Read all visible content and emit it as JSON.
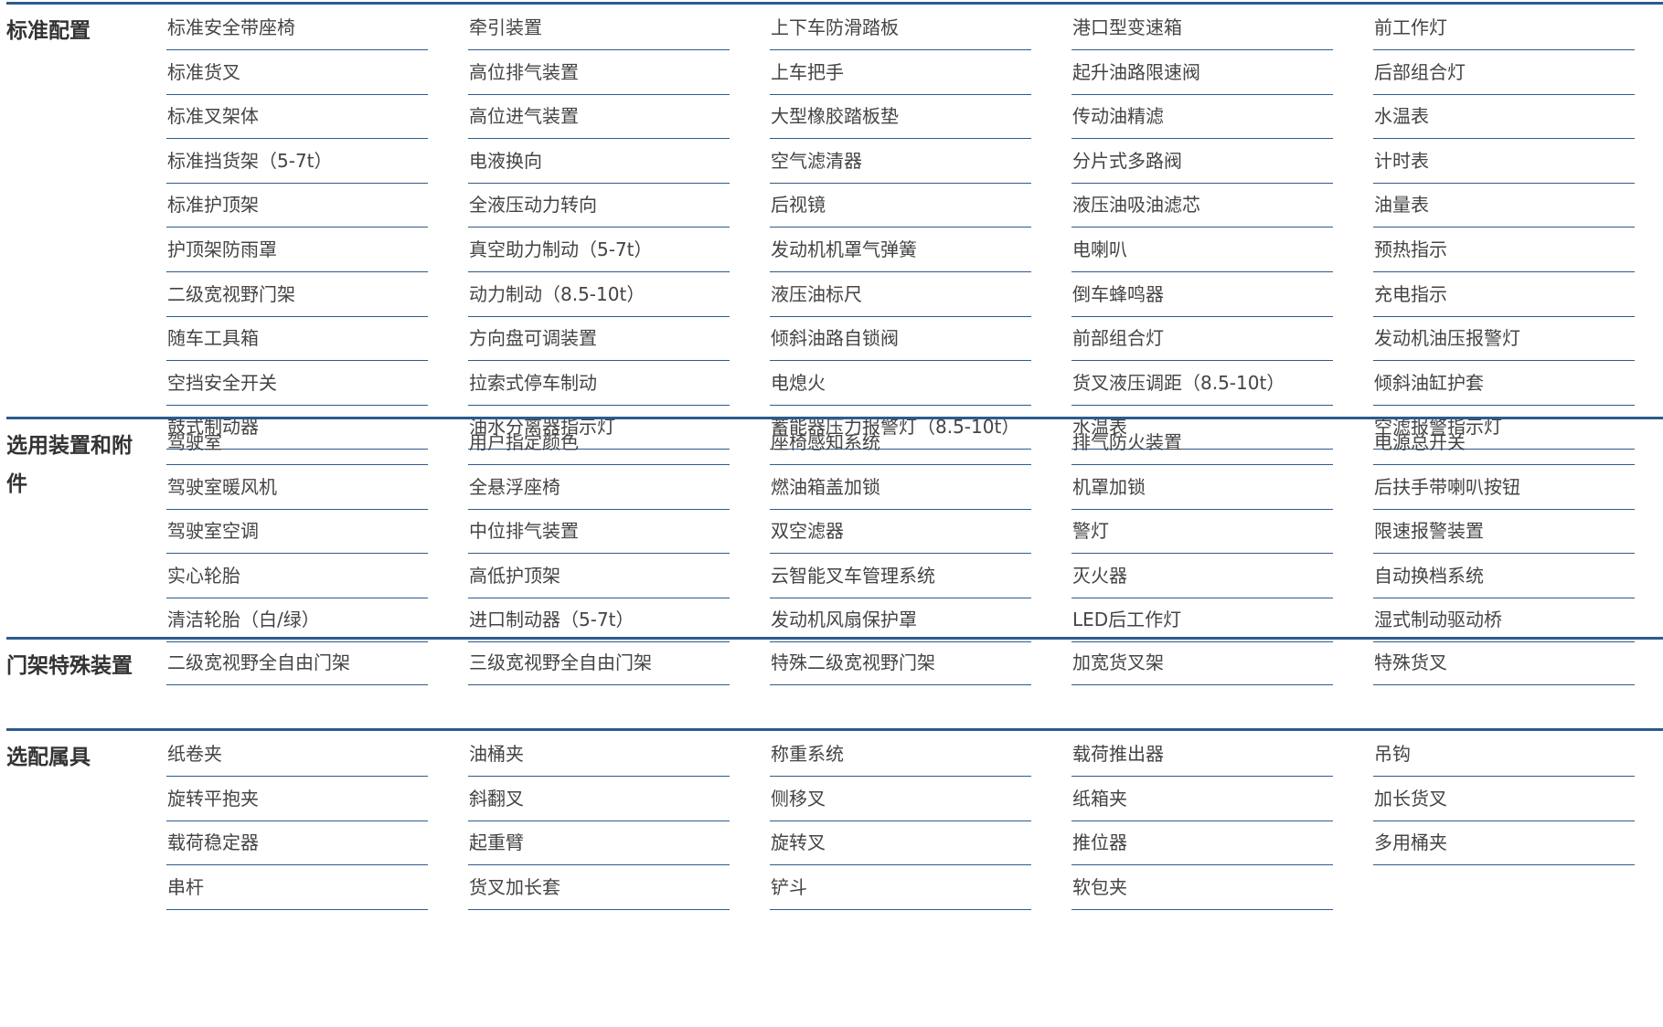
{
  "sections": [
    {
      "title": "标准配置",
      "items": [
        "标准安全带座椅",
        "牵引装置",
        "上下车防滑踏板",
        "港口型变速箱",
        "前工作灯",
        "标准货叉",
        "高位排气装置",
        "上车把手",
        "起升油路限速阀",
        "后部组合灯",
        "标准叉架体",
        "高位进气装置",
        "大型橡胶踏板垫",
        "传动油精滤",
        "水温表",
        "标准挡货架（5-7t）",
        "电液换向",
        "空气滤清器",
        "分片式多路阀",
        "计时表",
        "标准护顶架",
        "全液压动力转向",
        "后视镜",
        "液压油吸油滤芯",
        "油量表",
        "护顶架防雨罩",
        "真空助力制动（5-7t）",
        "发动机机罩气弹簧",
        "电喇叭",
        "预热指示",
        "二级宽视野门架",
        "动力制动（8.5-10t）",
        "液压油标尺",
        "倒车蜂鸣器",
        "充电指示",
        "随车工具箱",
        "方向盘可调装置",
        "倾斜油路自锁阀",
        "前部组合灯",
        "发动机油压报警灯",
        "空挡安全开关",
        "拉索式停车制动",
        "电熄火",
        "货叉液压调距（8.5-10t）",
        "倾斜油缸护套",
        "鼓式制动器",
        "油水分离器指示灯",
        "蓄能器压力报警灯（8.5-10t）",
        "水温表",
        "空滤报警指示灯"
      ]
    },
    {
      "title": "选用装置和附件",
      "items": [
        "驾驶室",
        "用户指定颜色",
        "座椅感知系统",
        "排气防火装置",
        "电源总开关",
        "驾驶室暖风机",
        "全悬浮座椅",
        "燃油箱盖加锁",
        "机罩加锁",
        "后扶手带喇叭按钮",
        "驾驶室空调",
        "中位排气装置",
        "双空滤器",
        "警灯",
        "限速报警装置",
        "实心轮胎",
        "高低护顶架",
        "云智能叉车管理系统",
        "灭火器",
        "自动换档系统",
        "清洁轮胎（白/绿）",
        "进口制动器（5-7t）",
        "发动机风扇保护罩",
        "LED后工作灯",
        "湿式制动驱动桥"
      ]
    },
    {
      "title": "门架特殊装置",
      "items": [
        "二级宽视野全自由门架",
        "三级宽视野全自由门架",
        "特殊二级宽视野门架",
        "加宽货叉架",
        "特殊货叉"
      ]
    },
    {
      "title": "选配属具",
      "items": [
        "纸卷夹",
        "油桶夹",
        "称重系统",
        "载荷推出器",
        "吊钩",
        "旋转平抱夹",
        "斜翻叉",
        "侧移叉",
        "纸箱夹",
        "加长货叉",
        "载荷稳定器",
        "起重臂",
        "旋转叉",
        "推位器",
        "多用桶夹",
        "串杆",
        "货叉加长套",
        "铲斗",
        "软包夹"
      ]
    }
  ]
}
